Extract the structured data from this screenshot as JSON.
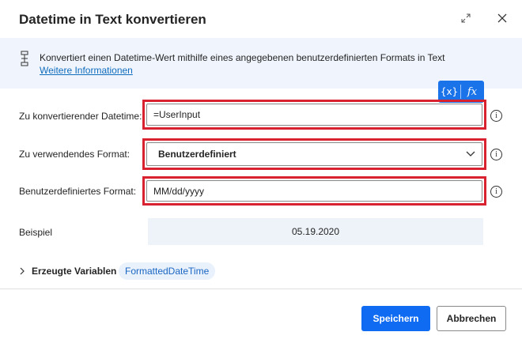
{
  "dialog": {
    "title": "Datetime in Text konvertieren",
    "expand_icon": "expand-icon",
    "close_icon": "close-icon"
  },
  "banner": {
    "icon": "action-icon",
    "description": "Konvertiert einen Datetime-Wert mithilfe eines angegebenen benutzerdefinierten Formats in Text",
    "link": "Weitere Informationen"
  },
  "toolbox": {
    "variables_label": "{x}",
    "fx_label": "fx"
  },
  "form": {
    "datetime_label": "Zu konvertierender Datetime:",
    "datetime_value": "=UserInput",
    "format_label": "Zu verwendendes Format:",
    "format_value": "Benutzerdefiniert",
    "custom_format_label": "Benutzerdefiniertes Format:",
    "custom_format_value": "MM/dd/yyyy",
    "example_label": "Beispiel",
    "example_value": "05.19.2020",
    "info_glyph": "i"
  },
  "variables": {
    "section_label": "Erzeugte Variablen",
    "chip": "FormattedDateTime"
  },
  "footer": {
    "save_label": "Speichern",
    "cancel_label": "Abbrechen"
  },
  "colors": {
    "accent": "#0f6cf2",
    "highlight_border": "#d9222f",
    "banner_bg": "#f0f5fd"
  }
}
